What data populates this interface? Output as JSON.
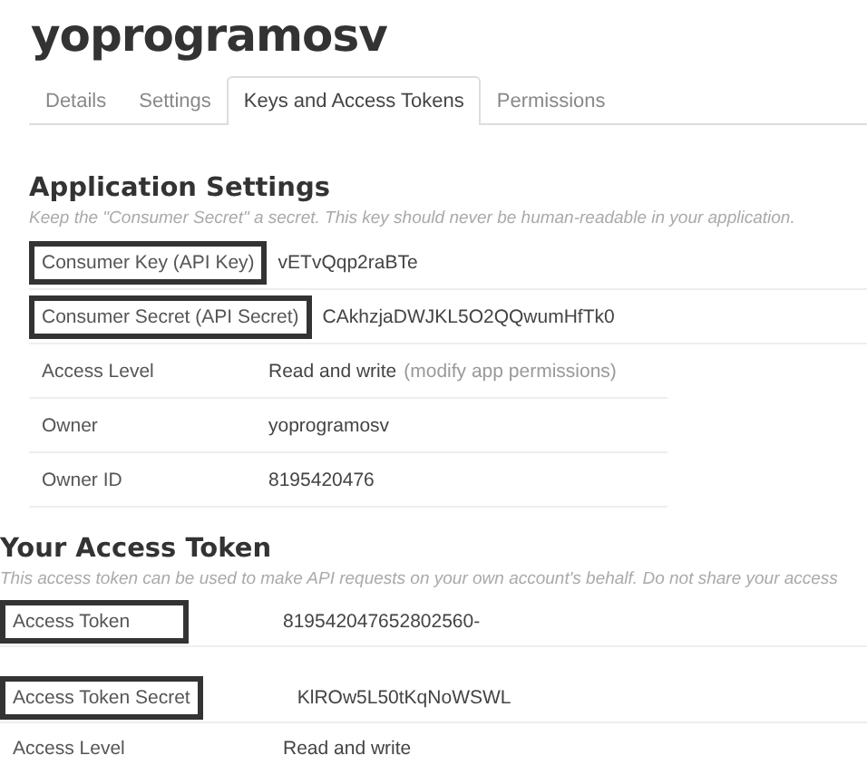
{
  "app_title": "yoprogramosv",
  "tabs": [
    {
      "label": "Details",
      "selected": false
    },
    {
      "label": "Settings",
      "selected": false
    },
    {
      "label": "Keys and Access Tokens",
      "selected": true
    },
    {
      "label": "Permissions",
      "selected": false
    }
  ],
  "sections": [
    {
      "heading": "Application Settings",
      "description": "Keep the \"Consumer Secret\" a secret. This key should never be human-readable in your application.",
      "rows": [
        {
          "label": "Consumer Key (API Key)",
          "value": "vETvQqp2raBTe",
          "highlighted": true
        },
        {
          "label": "Consumer Secret (API Secret)",
          "value": "CAkhzjaDWJKL5O2QQwumHfTk0",
          "highlighted": true
        },
        {
          "label": "Access Level",
          "value": "Read and write",
          "link": "(modify app permissions)",
          "highlighted": false
        },
        {
          "label": "Owner",
          "value": "yoprogramosv",
          "highlighted": false
        },
        {
          "label": "Owner ID",
          "value": "8195420476",
          "highlighted": false
        }
      ]
    },
    {
      "heading": "Your Access Token",
      "description": "This access token can be used to make API requests on your own account's behalf. Do not share your access",
      "rows": [
        {
          "label": "Access Token",
          "value": "819542047652802560-",
          "highlighted": true
        },
        {
          "label": "Access Token Secret",
          "value": "KlROw5L50tKqNoWSWL",
          "highlighted": true
        },
        {
          "label": "Access Level",
          "value": "Read and write",
          "highlighted": false
        }
      ]
    }
  ]
}
